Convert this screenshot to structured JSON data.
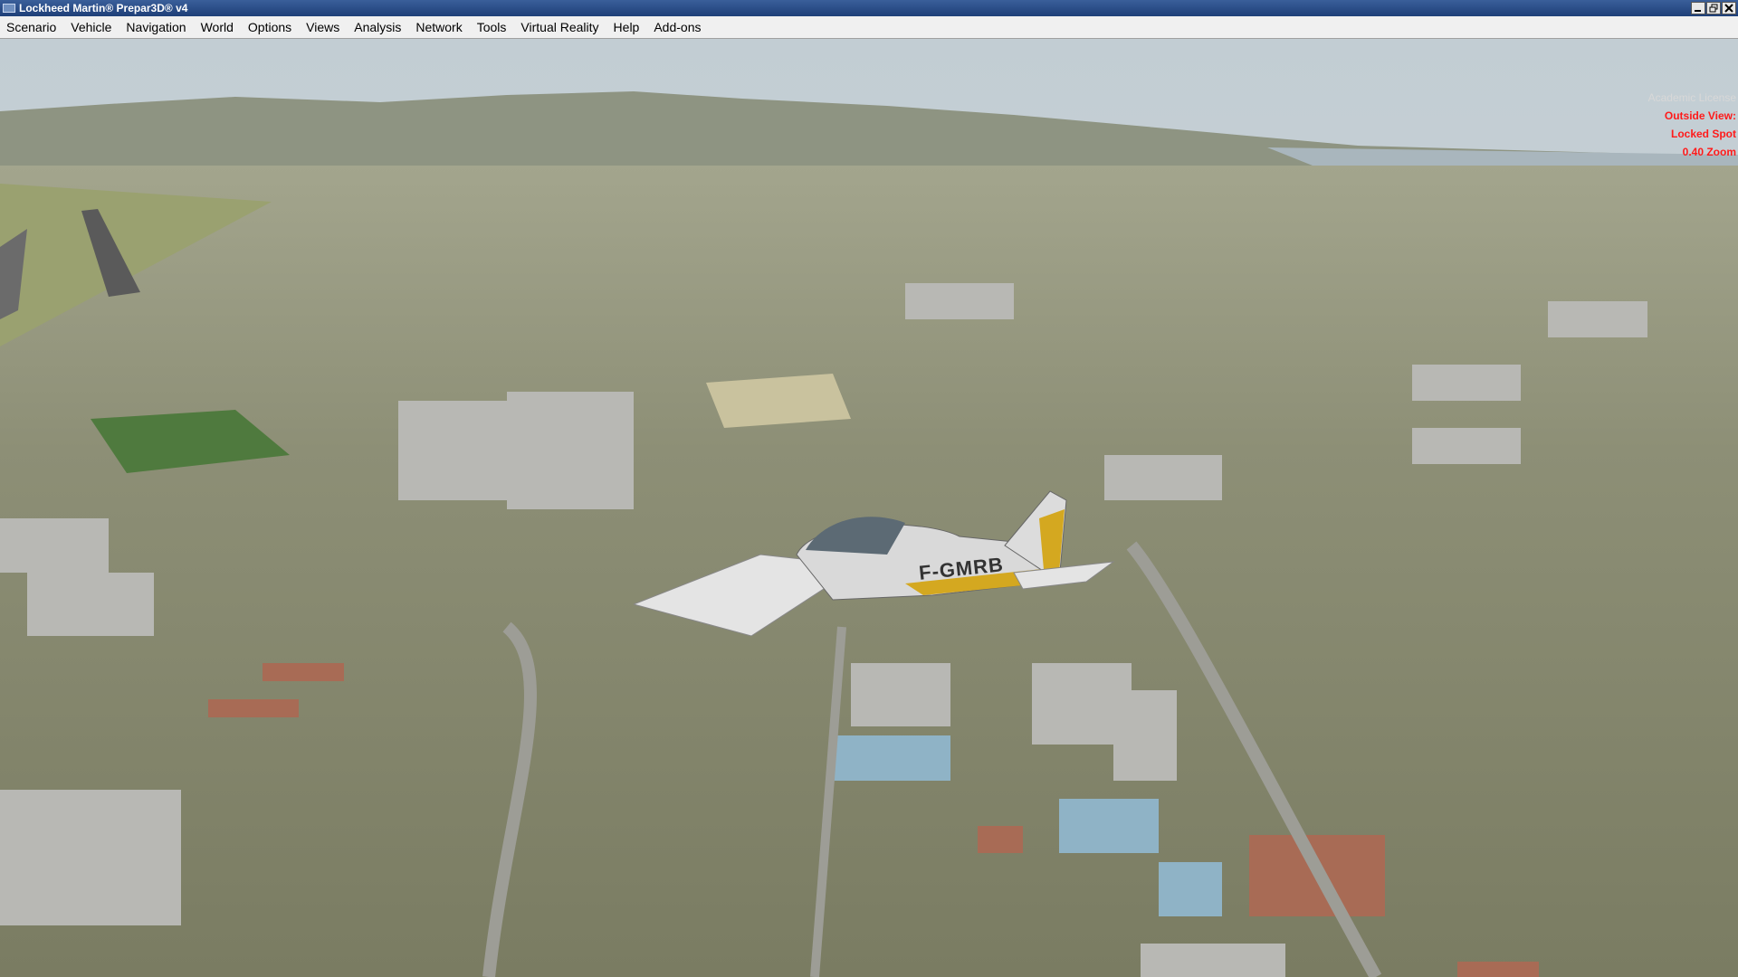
{
  "window": {
    "title": "Lockheed Martin® Prepar3D® v4",
    "icon": "app-icon"
  },
  "menu": {
    "items": [
      {
        "id": "scenario",
        "label": "Scenario"
      },
      {
        "id": "vehicle",
        "label": "Vehicle"
      },
      {
        "id": "navigation",
        "label": "Navigation"
      },
      {
        "id": "world",
        "label": "World"
      },
      {
        "id": "options",
        "label": "Options"
      },
      {
        "id": "views",
        "label": "Views"
      },
      {
        "id": "analysis",
        "label": "Analysis"
      },
      {
        "id": "network",
        "label": "Network"
      },
      {
        "id": "tools",
        "label": "Tools"
      },
      {
        "id": "virtual-reality",
        "label": "Virtual Reality"
      },
      {
        "id": "help",
        "label": "Help"
      },
      {
        "id": "add-ons",
        "label": "Add-ons"
      }
    ]
  },
  "overlay": {
    "license": "Academic License",
    "view_label": "Outside View:",
    "view_mode": "Locked Spot",
    "zoom": "0.40 Zoom"
  },
  "aircraft": {
    "registration": "F-GMRB"
  },
  "colors": {
    "overlay_red": "#ff1a1a",
    "titlebar": "#1e3f78",
    "sky": "#c9d3d8",
    "terrain": "#8f957a"
  }
}
